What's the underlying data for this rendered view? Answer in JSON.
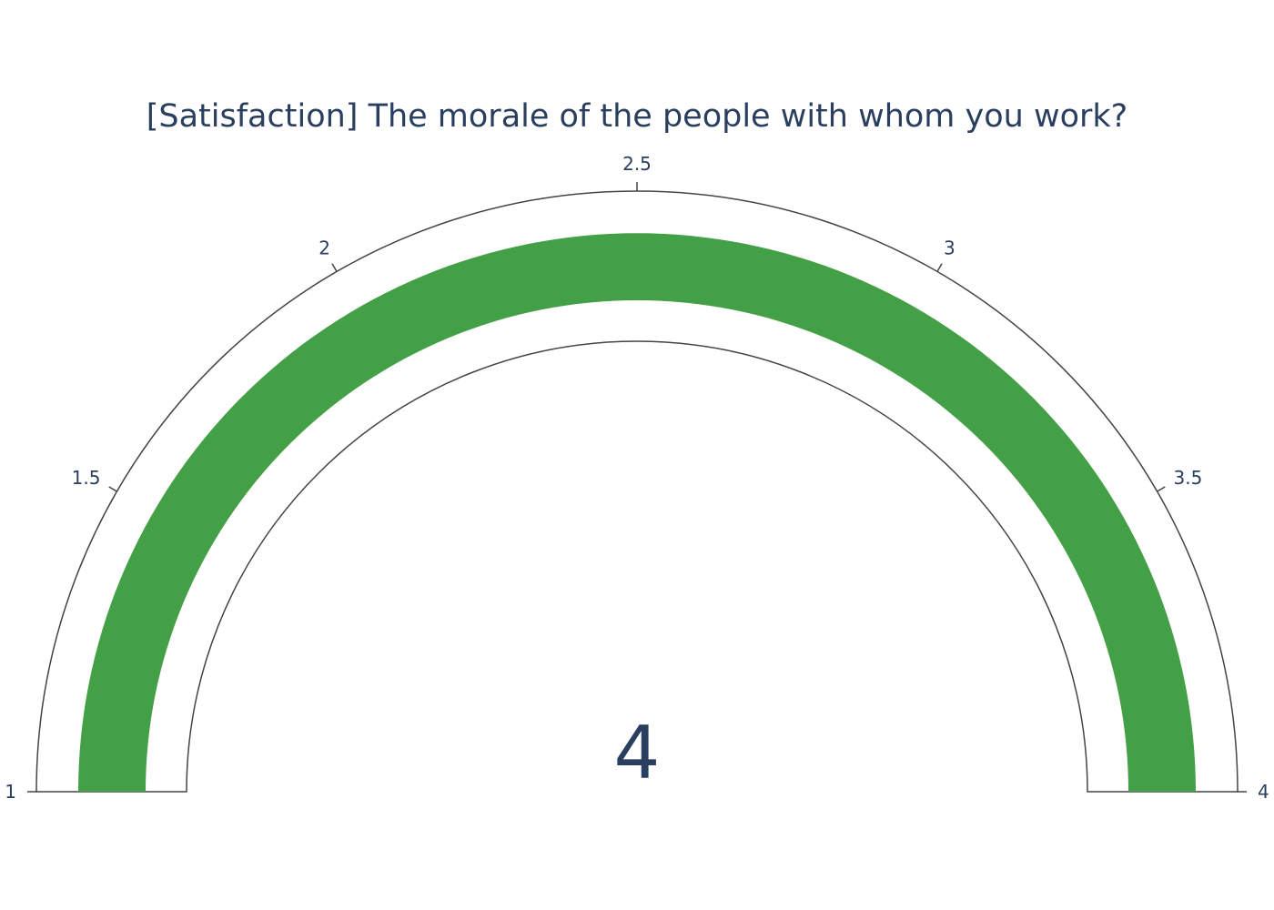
{
  "chart_data": {
    "type": "gauge",
    "title": "[Satisfaction] The morale of the people with whom you work?",
    "value": 4,
    "value_label": "4",
    "range": [
      1,
      4
    ],
    "ticks": [
      {
        "value": 1,
        "label": "1"
      },
      {
        "value": 1.5,
        "label": "1.5"
      },
      {
        "value": 2,
        "label": "2"
      },
      {
        "value": 2.5,
        "label": "2.5"
      },
      {
        "value": 3,
        "label": "3"
      },
      {
        "value": 3.5,
        "label": "3.5"
      },
      {
        "value": 4,
        "label": "4"
      }
    ],
    "bar_color": "#44a047",
    "outline_color": "#444444",
    "text_color": "#2a3f5f",
    "background_color": "#ffffff"
  }
}
